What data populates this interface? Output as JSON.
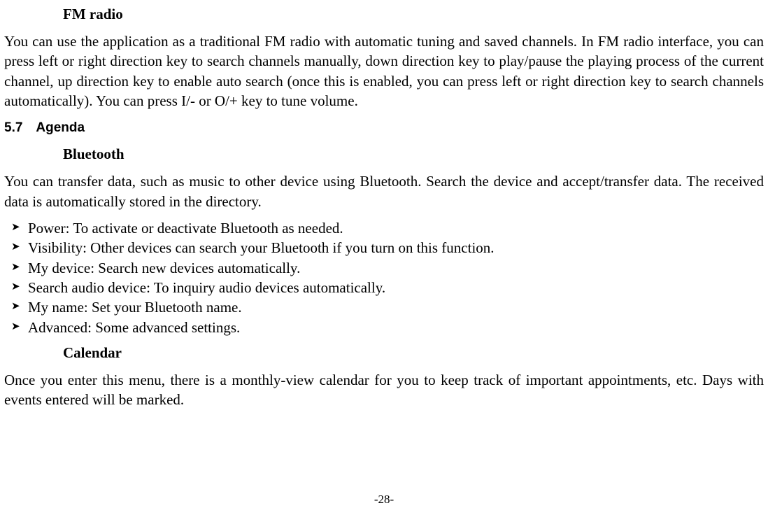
{
  "headings": {
    "fmRadio": "FM radio",
    "agenda": "5.7 Agenda",
    "bluetooth": "Bluetooth",
    "calendar": "Calendar"
  },
  "paragraphs": {
    "fmRadioBody": "You can use the application as a traditional FM radio with automatic tuning and saved channels. In FM radio interface, you can press left or right direction key to search channels manually, down direction key to play/pause the playing process of the current channel, up direction key to enable auto search (once this is enabled, you can press left or right direction key to search channels automatically). You can press I/- or O/+ key to tune volume.",
    "bluetoothBody": "You can transfer data, such as music to other device using Bluetooth. Search the device and accept/transfer data. The received data is automatically stored in the directory.",
    "calendarBody": "Once you enter this menu, there is a monthly-view calendar for you to keep track of important appointments, etc. Days with events entered will be marked."
  },
  "bullets": [
    "Power: To activate or deactivate Bluetooth as needed.",
    "Visibility: Other devices can search your Bluetooth if you turn on this function.",
    "My device: Search new devices automatically.",
    "Search audio device: To inquiry audio devices automatically.",
    "My name: Set your Bluetooth name.",
    "Advanced: Some advanced settings."
  ],
  "pageNumber": "-28-"
}
